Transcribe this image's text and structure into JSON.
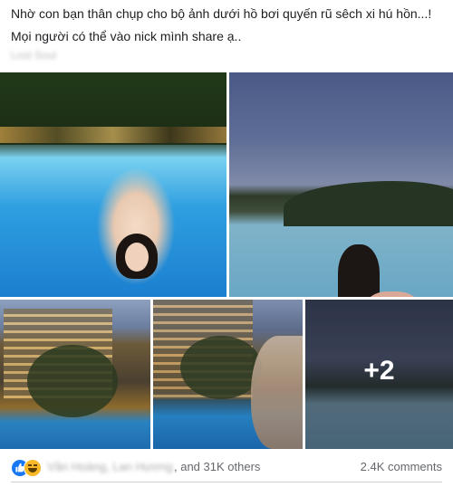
{
  "post": {
    "caption_line1": "Nhờ con bạn thân chụp cho bộ ảnh dưới hồ bơi quyến rũ sêch xi hú hồn...!",
    "caption_line2": "Mọi người có thể vào nick mình share ạ..",
    "blurred_link": "Lost Soul",
    "more_photos": "+2"
  },
  "footer": {
    "blurred_names": "Văn Hoàng, Lan Hương",
    "reactions_text": ", and 31K others",
    "comments": "2.4K comments"
  },
  "icons": {
    "like": "like-icon",
    "haha": "haha-icon"
  },
  "colors": {
    "like_blue": "#1877f2",
    "haha_yellow": "#f7b928",
    "text_primary": "#1c1e21",
    "text_secondary": "#65676b"
  }
}
